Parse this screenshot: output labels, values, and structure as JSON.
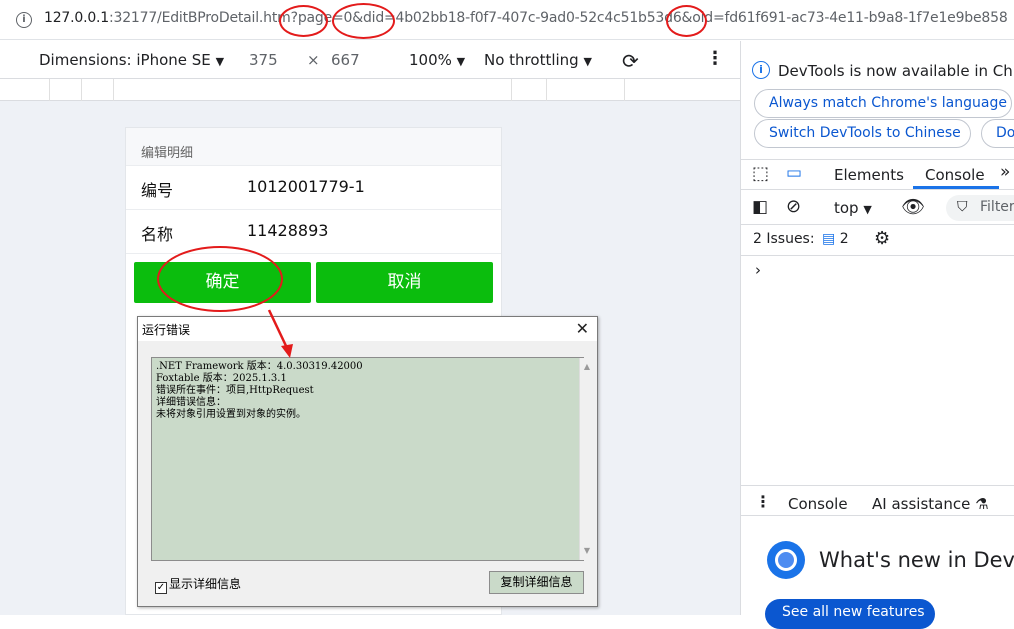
{
  "address_bar": {
    "url_host": "127.0.0.1",
    "url_rest": ":32177/EditBProDetail.htm?page=0&did=4b02bb18-f0f7-407c-9ad0-52c4c51b53d6&oid=fd61f691-ac73-4e11-b9a8-1f7e1e9be858"
  },
  "device_toolbar": {
    "dimensions_label": "Dimensions: iPhone SE",
    "width": "375",
    "times": "×",
    "height": "667",
    "zoom": "100%",
    "throttling": "No throttling"
  },
  "mobile_page": {
    "section_title": "编辑明细",
    "fields": [
      {
        "label": "编号",
        "value": "1012001779-1"
      },
      {
        "label": "名称",
        "value": "11428893"
      }
    ],
    "confirm_label": "确定",
    "cancel_label": "取消"
  },
  "error_dialog": {
    "title": "运行错误",
    "message": ".NET Framework 版本：4.0.30319.42000\nFoxtable 版本：2025.1.3.1\n错误所在事件：项目,HttpRequest\n详细错误信息：\n未将对象引用设置到对象的实例。",
    "show_details_label": "显示详细信息",
    "show_details_checked": true,
    "copy_button_label": "复制详细信息"
  },
  "devtools": {
    "notice": "DevTools is now available in Chin",
    "btn_match_language": "Always match Chrome's language",
    "btn_switch_chinese": "Switch DevTools to Chinese",
    "btn_third_partial": "Do",
    "tab_elements": "Elements",
    "tab_console": "Console",
    "context": "top",
    "filter_placeholder": "Filter",
    "issues_label": "2 Issues:",
    "issues_count": "2",
    "drawer_console": "Console",
    "drawer_ai": "AI assistance",
    "whats_new": "What's new in DevTo",
    "see_all": "See all new features"
  },
  "colors": {
    "green_button": "#0bbd0d",
    "annotation_red": "#e31b1b",
    "devtools_blue": "#1a73e8"
  }
}
